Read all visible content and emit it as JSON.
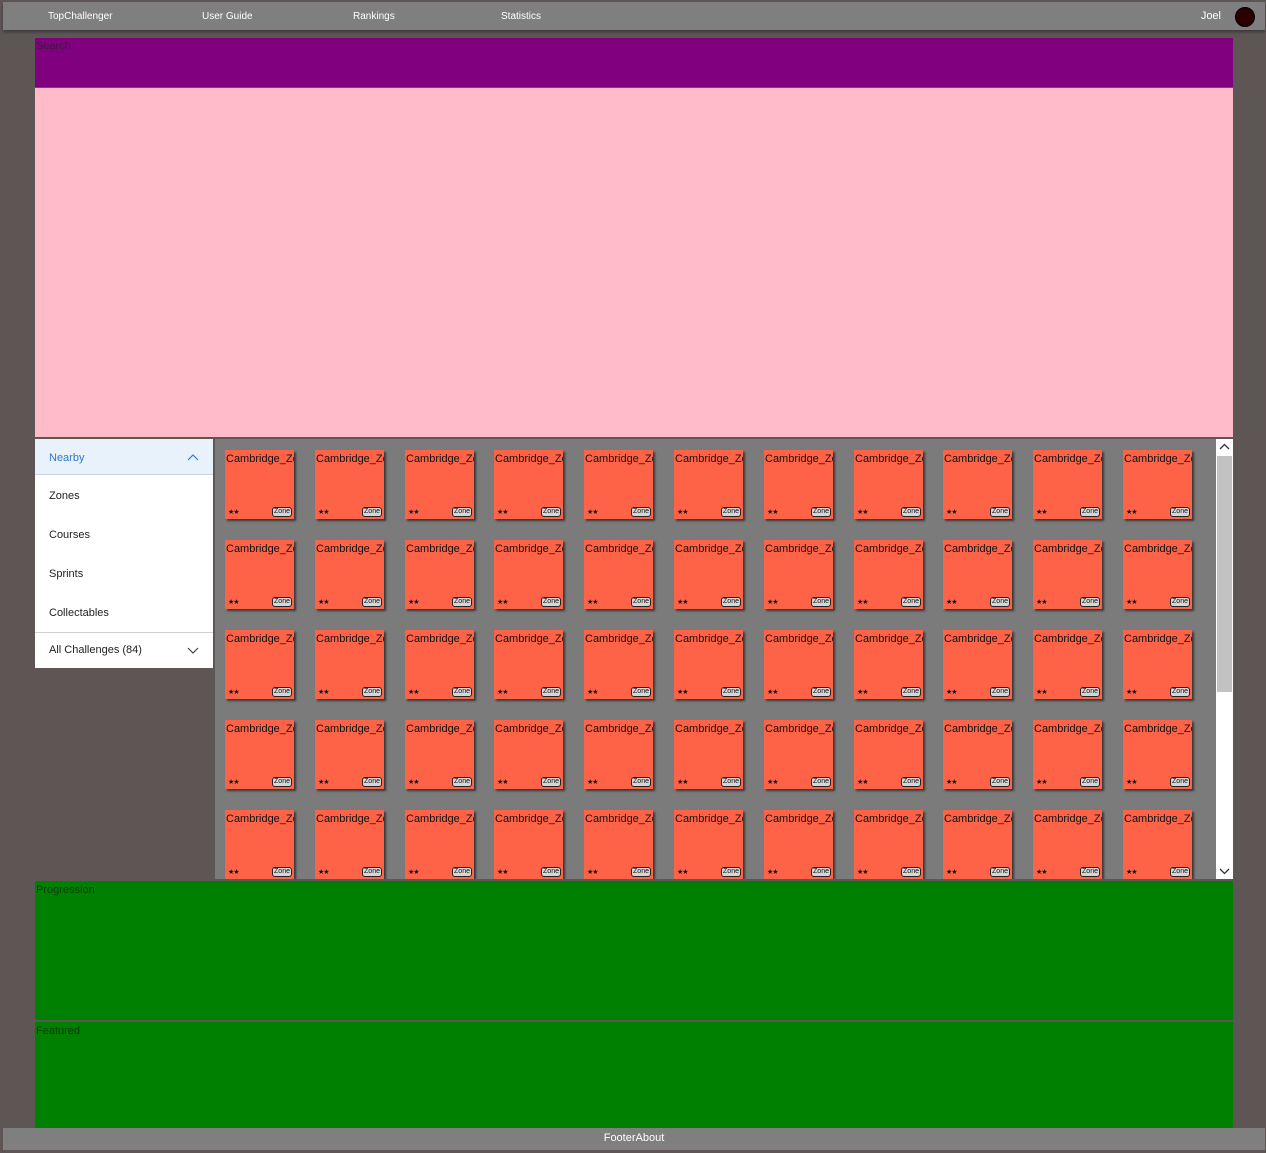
{
  "nav": {
    "items": [
      "TopChallenger",
      "User Guide",
      "Rankings",
      "Statistics"
    ],
    "user_name": "Joel"
  },
  "search": {
    "label": "Search"
  },
  "filter_panel": {
    "selected": "Nearby",
    "items": [
      "Zones",
      "Courses",
      "Sprints",
      "Collectables"
    ],
    "footer": "All Challenges (84)"
  },
  "challenges": {
    "tiles": [
      {
        "title": "Cambridge_Zone",
        "stars": "★★",
        "badge": "Zone"
      },
      {
        "title": "Cambridge_Zone",
        "stars": "★★",
        "badge": "Zone"
      },
      {
        "title": "Cambridge_Zone",
        "stars": "★★",
        "badge": "Zone"
      },
      {
        "title": "Cambridge_Zone",
        "stars": "★★",
        "badge": "Zone"
      },
      {
        "title": "Cambridge_Zone",
        "stars": "★★",
        "badge": "Zone"
      },
      {
        "title": "Cambridge_Zone",
        "stars": "★★",
        "badge": "Zone"
      },
      {
        "title": "Cambridge_Zone",
        "stars": "★★",
        "badge": "Zone"
      },
      {
        "title": "Cambridge_Zone",
        "stars": "★★",
        "badge": "Zone"
      },
      {
        "title": "Cambridge_Zone",
        "stars": "★★",
        "badge": "Zone"
      },
      {
        "title": "Cambridge_Zone",
        "stars": "★★",
        "badge": "Zone"
      },
      {
        "title": "Cambridge_Zone",
        "stars": "★★",
        "badge": "Zone"
      },
      {
        "title": "Cambridge_Zone",
        "stars": "★★",
        "badge": "Zone"
      },
      {
        "title": "Cambridge_Zone",
        "stars": "★★",
        "badge": "Zone"
      },
      {
        "title": "Cambridge_Zone",
        "stars": "★★",
        "badge": "Zone"
      },
      {
        "title": "Cambridge_Zone",
        "stars": "★★",
        "badge": "Zone"
      },
      {
        "title": "Cambridge_Zone",
        "stars": "★★",
        "badge": "Zone"
      },
      {
        "title": "Cambridge_Zone",
        "stars": "★★",
        "badge": "Zone"
      },
      {
        "title": "Cambridge_Zone",
        "stars": "★★",
        "badge": "Zone"
      },
      {
        "title": "Cambridge_Zone",
        "stars": "★★",
        "badge": "Zone"
      },
      {
        "title": "Cambridge_Zone",
        "stars": "★★",
        "badge": "Zone"
      },
      {
        "title": "Cambridge_Zone",
        "stars": "★★",
        "badge": "Zone"
      },
      {
        "title": "Cambridge_Zone",
        "stars": "★★",
        "badge": "Zone"
      },
      {
        "title": "Cambridge_Zone",
        "stars": "★★",
        "badge": "Zone"
      },
      {
        "title": "Cambridge_Zone",
        "stars": "★★",
        "badge": "Zone"
      },
      {
        "title": "Cambridge_Zone",
        "stars": "★★",
        "badge": "Zone"
      },
      {
        "title": "Cambridge_Zone",
        "stars": "★★",
        "badge": "Zone"
      },
      {
        "title": "Cambridge_Zone",
        "stars": "★★",
        "badge": "Zone"
      },
      {
        "title": "Cambridge_Zone",
        "stars": "★★",
        "badge": "Zone"
      },
      {
        "title": "Cambridge_Zone",
        "stars": "★★",
        "badge": "Zone"
      },
      {
        "title": "Cambridge_Zone",
        "stars": "★★",
        "badge": "Zone"
      },
      {
        "title": "Cambridge_Zone",
        "stars": "★★",
        "badge": "Zone"
      },
      {
        "title": "Cambridge_Zone",
        "stars": "★★",
        "badge": "Zone"
      },
      {
        "title": "Cambridge_Zone",
        "stars": "★★",
        "badge": "Zone"
      },
      {
        "title": "Cambridge_Zone",
        "stars": "★★",
        "badge": "Zone"
      },
      {
        "title": "Cambridge_Zone",
        "stars": "★★",
        "badge": "Zone"
      },
      {
        "title": "Cambridge_Zone",
        "stars": "★★",
        "badge": "Zone"
      },
      {
        "title": "Cambridge_Zone",
        "stars": "★★",
        "badge": "Zone"
      },
      {
        "title": "Cambridge_Zone",
        "stars": "★★",
        "badge": "Zone"
      },
      {
        "title": "Cambridge_Zone",
        "stars": "★★",
        "badge": "Zone"
      },
      {
        "title": "Cambridge_Zone",
        "stars": "★★",
        "badge": "Zone"
      },
      {
        "title": "Cambridge_Zone",
        "stars": "★★",
        "badge": "Zone"
      },
      {
        "title": "Cambridge_Zone",
        "stars": "★★",
        "badge": "Zone"
      },
      {
        "title": "Cambridge_Zone",
        "stars": "★★",
        "badge": "Zone"
      },
      {
        "title": "Cambridge_Zone",
        "stars": "★★",
        "badge": "Zone"
      },
      {
        "title": "Cambridge_Zone",
        "stars": "★★",
        "badge": "Zone"
      },
      {
        "title": "Cambridge_Zone",
        "stars": "★★",
        "badge": "Zone"
      },
      {
        "title": "Cambridge_Zone",
        "stars": "★★",
        "badge": "Zone"
      },
      {
        "title": "Cambridge_Zone",
        "stars": "★★",
        "badge": "Zone"
      },
      {
        "title": "Cambridge_Zone",
        "stars": "★★",
        "badge": "Zone"
      },
      {
        "title": "Cambridge_Zone",
        "stars": "★★",
        "badge": "Zone"
      },
      {
        "title": "Cambridge_Zone",
        "stars": "★★",
        "badge": "Zone"
      },
      {
        "title": "Cambridge_Zone",
        "stars": "★★",
        "badge": "Zone"
      },
      {
        "title": "Cambridge_Zone",
        "stars": "★★",
        "badge": "Zone"
      },
      {
        "title": "Cambridge_Zone",
        "stars": "★★",
        "badge": "Zone"
      },
      {
        "title": "Cambridge_Zone",
        "stars": "★★",
        "badge": "Zone"
      }
    ]
  },
  "progression": {
    "label": "Progression"
  },
  "featured": {
    "label": "Featured"
  },
  "footer": {
    "text": "FooterAbout"
  },
  "colors": {
    "background": "#5e5655",
    "nav": "#807f7f",
    "search": "#800080",
    "pink_panel": "#ffbcc8",
    "tile": "#ff6347",
    "grid_bg": "#7b7b7b",
    "green_panels": "#008000",
    "accent": "#2b7ad0"
  }
}
